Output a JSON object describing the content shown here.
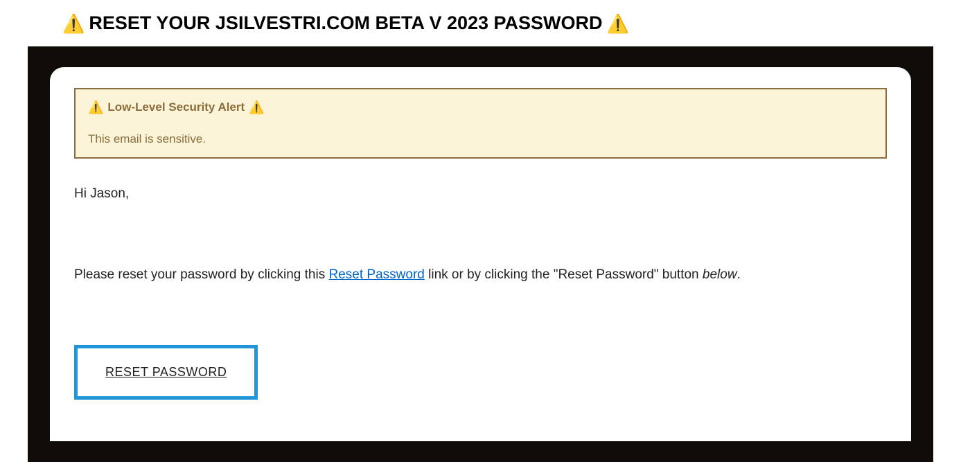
{
  "header": {
    "title": "RESET YOUR JSILVESTRI.COM BETA V 2023 PASSWORD",
    "warning_emoji": "⚠️"
  },
  "alert": {
    "title": "Low-Level Security Alert",
    "body": "This email is sensitive.",
    "warning_emoji": "⚠️"
  },
  "body": {
    "greeting": "Hi Jason,",
    "instruction_prefix": "Please reset your password by clicking this ",
    "link_text": "Reset Password",
    "instruction_middle": " link or by clicking the \"Reset Password\" button ",
    "instruction_emphasis": "below",
    "instruction_suffix": "."
  },
  "button": {
    "label": "RESET PASSWORD"
  }
}
